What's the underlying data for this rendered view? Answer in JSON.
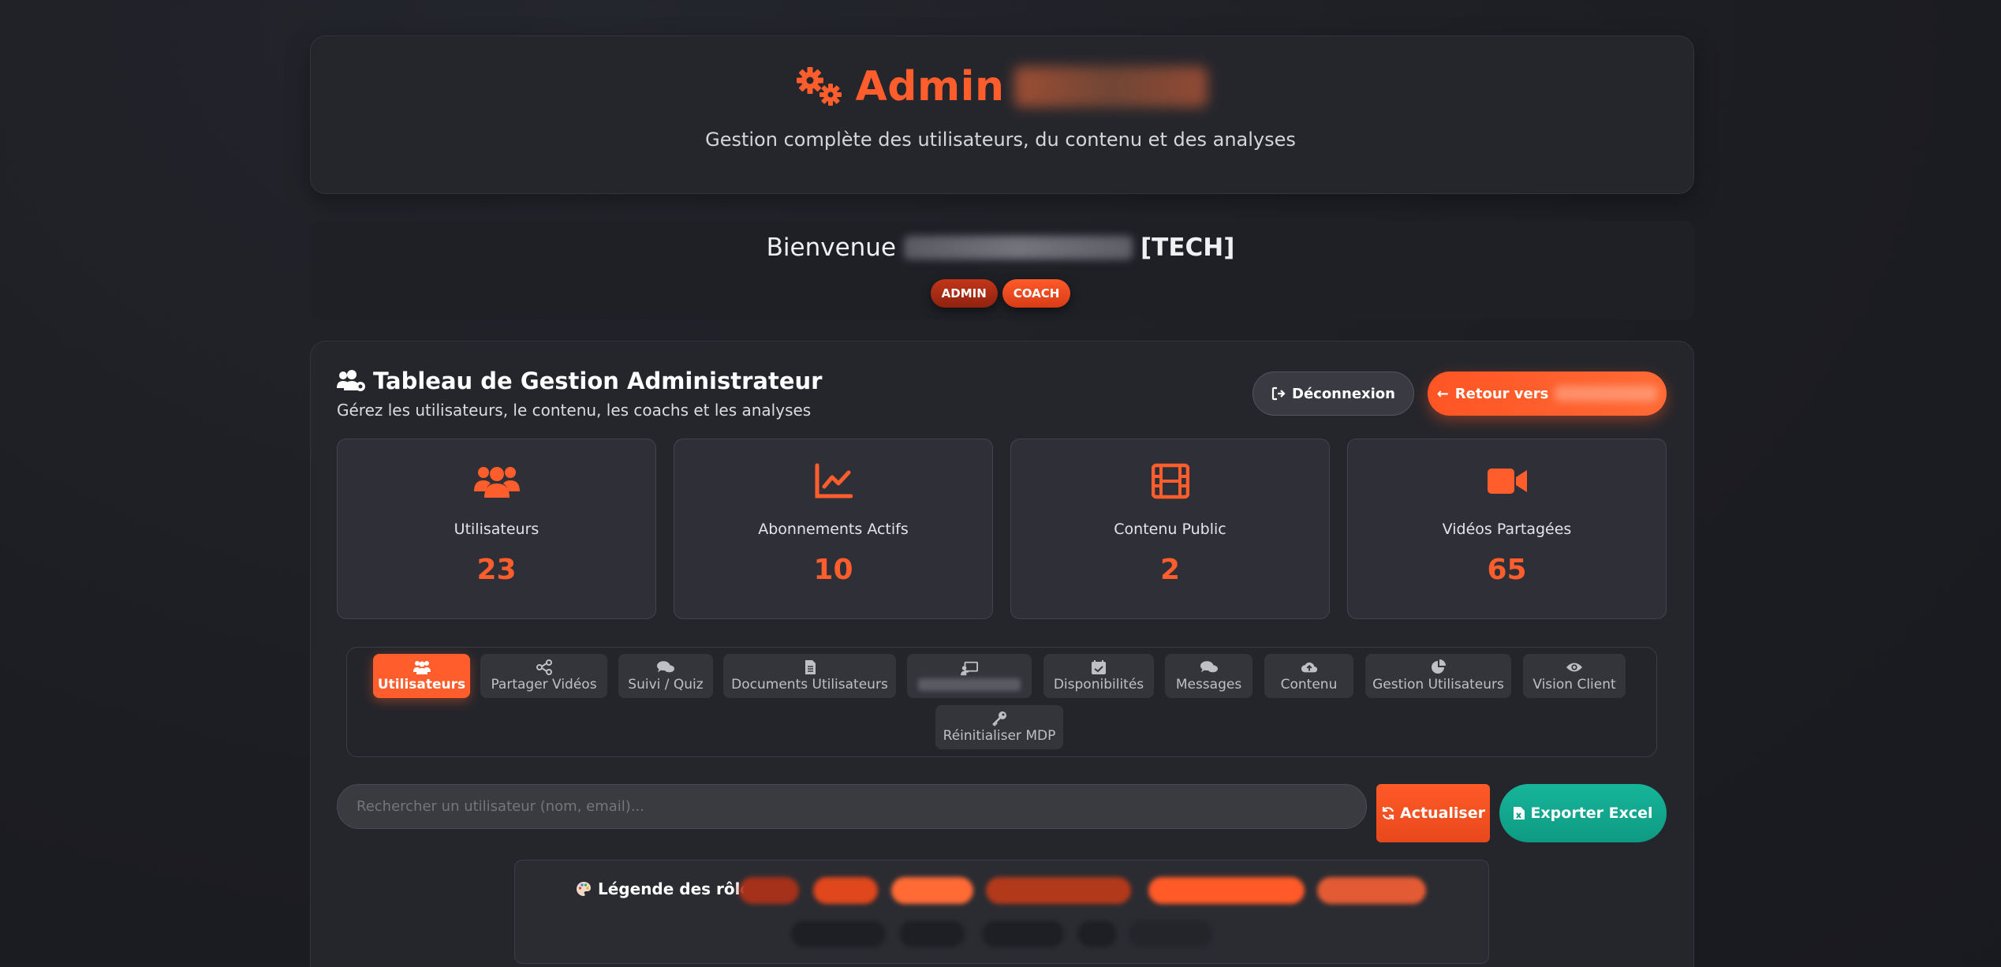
{
  "header": {
    "title": "Admin",
    "subtitle": "Gestion complète des utilisateurs, du contenu et des analyses"
  },
  "welcome": {
    "greeting": "Bienvenue",
    "suffix": "[TECH]",
    "badges": [
      "ADMIN",
      "COACH"
    ]
  },
  "panel": {
    "title": "Tableau de Gestion Administrateur",
    "subtitle": "Gérez les utilisateurs, le contenu, les coachs et les analyses",
    "logout_label": "Déconnexion",
    "return_label": "Retour vers"
  },
  "stats": [
    {
      "label": "Utilisateurs",
      "value": "23",
      "icon": "users-icon"
    },
    {
      "label": "Abonnements Actifs",
      "value": "10",
      "icon": "chart-line-icon"
    },
    {
      "label": "Contenu Public",
      "value": "2",
      "icon": "film-icon"
    },
    {
      "label": "Vidéos Partagées",
      "value": "65",
      "icon": "video-camera-icon"
    }
  ],
  "tabs": [
    {
      "label": "Utilisateurs",
      "icon": "users-icon",
      "active": true
    },
    {
      "label": "Partager Vidéos",
      "icon": "share-icon"
    },
    {
      "label": "Suivi / Quiz",
      "icon": "comments-icon"
    },
    {
      "label": "Documents Utilisateurs",
      "icon": "document-icon"
    },
    {
      "label": "",
      "icon": "presentation-icon"
    },
    {
      "label": "Disponibilités",
      "icon": "calendar-check-icon"
    },
    {
      "label": "Messages",
      "icon": "messages-icon"
    },
    {
      "label": "Contenu",
      "icon": "cloud-upload-icon"
    },
    {
      "label": "Gestion Utilisateurs",
      "icon": "pie-chart-icon"
    },
    {
      "label": "Vision Client",
      "icon": "eye-icon"
    },
    {
      "label": "Réinitialiser MDP",
      "icon": "key-icon"
    }
  ],
  "search": {
    "placeholder": "Rechercher un utilisateur (nom, email)..."
  },
  "actions": {
    "refresh_label": "Actualiser",
    "export_label": "Exporter Excel"
  },
  "legend": {
    "title": "Légende des rôles"
  },
  "colors": {
    "accent": "#ff5e2c",
    "export": "#12a88e",
    "background": "#1c1d22",
    "card": "#25262c"
  }
}
